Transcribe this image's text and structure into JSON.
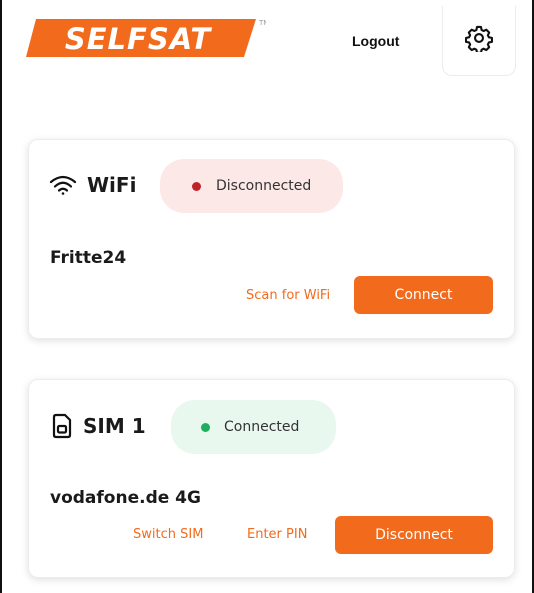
{
  "brand": {
    "logo_text": "SELFSAT",
    "trademark": "TM",
    "accent_color": "#f26b1d"
  },
  "header": {
    "logout_label": "Logout",
    "settings_icon": "gear-icon"
  },
  "wifi": {
    "title": "WiFi",
    "icon": "wifi-icon",
    "status": "Disconnected",
    "status_color": "#c0222a",
    "network": "Fritte24",
    "scan_label": "Scan for WiFi",
    "connect_label": "Connect"
  },
  "sim": {
    "title": "SIM 1",
    "icon": "sim-card-icon",
    "status": "Connected",
    "status_color": "#1fae5b",
    "network": "vodafone.de 4G",
    "switch_label": "Switch SIM",
    "pin_label": "Enter PIN",
    "disconnect_label": "Disconnect"
  }
}
